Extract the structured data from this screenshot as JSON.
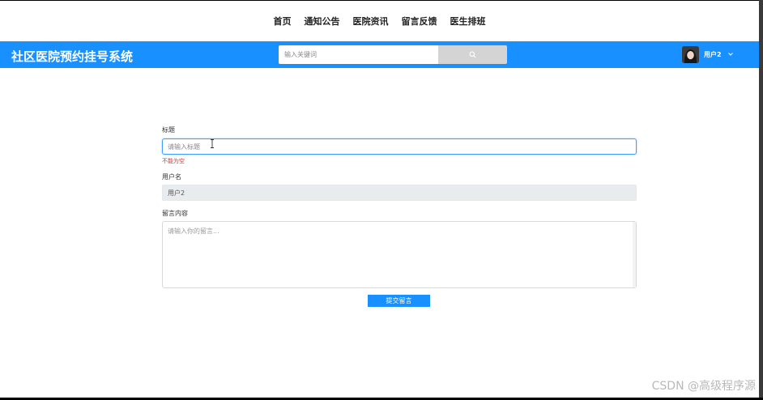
{
  "topnav": {
    "items": [
      "首页",
      "通知公告",
      "医院资讯",
      "留言反馈",
      "医生排班"
    ]
  },
  "header": {
    "title": "社区医院预约挂号系统",
    "search_placeholder": "输入关键词",
    "user_name": "用户2",
    "color": "#1890ff"
  },
  "form": {
    "title_label": "标题",
    "title_placeholder": "请输入标题",
    "title_error": "不能为空",
    "username_label": "用户名",
    "username_value": "用户2",
    "content_label": "留言内容",
    "content_placeholder": "请输入你的留言...",
    "submit_label": "提交留言"
  },
  "watermark": "CSDN @高级程序源",
  "icons": [
    "search-icon",
    "chevron-down-icon",
    "text-cursor-icon"
  ]
}
